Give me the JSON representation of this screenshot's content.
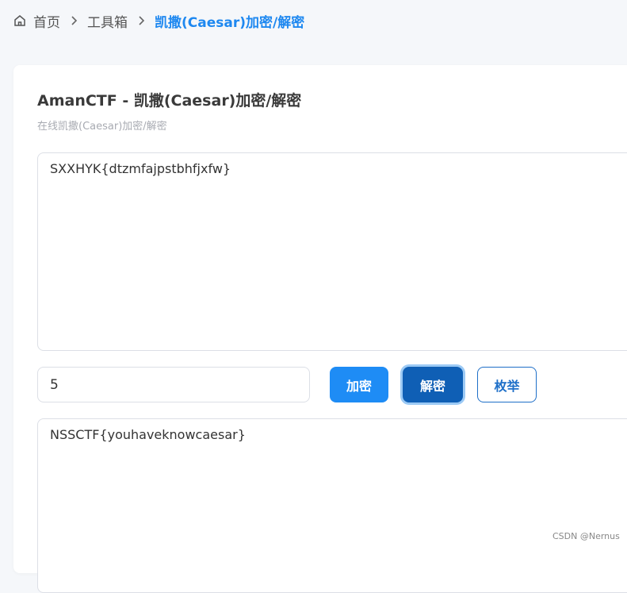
{
  "breadcrumb": {
    "home": "首页",
    "toolbox": "工具箱",
    "current": "凯撒(Caesar)加密/解密"
  },
  "card": {
    "title": "AmanCTF - 凯撒(Caesar)加密/解密",
    "subtitle": "在线凯撒(Caesar)加密/解密"
  },
  "input_text": "SXXHYK{dtzmfajpstbhfjxfw}",
  "shift_value": "5",
  "buttons": {
    "encrypt": "加密",
    "decrypt": "解密",
    "enumerate": "枚举"
  },
  "output_text": "NSSCTF{youhaveknowcaesar}",
  "watermark": "CSDN @Nernus",
  "colors": {
    "primary": "#1e8cf5",
    "active": "#0f5fb5",
    "breadcrumb_current": "#1e88f0"
  }
}
